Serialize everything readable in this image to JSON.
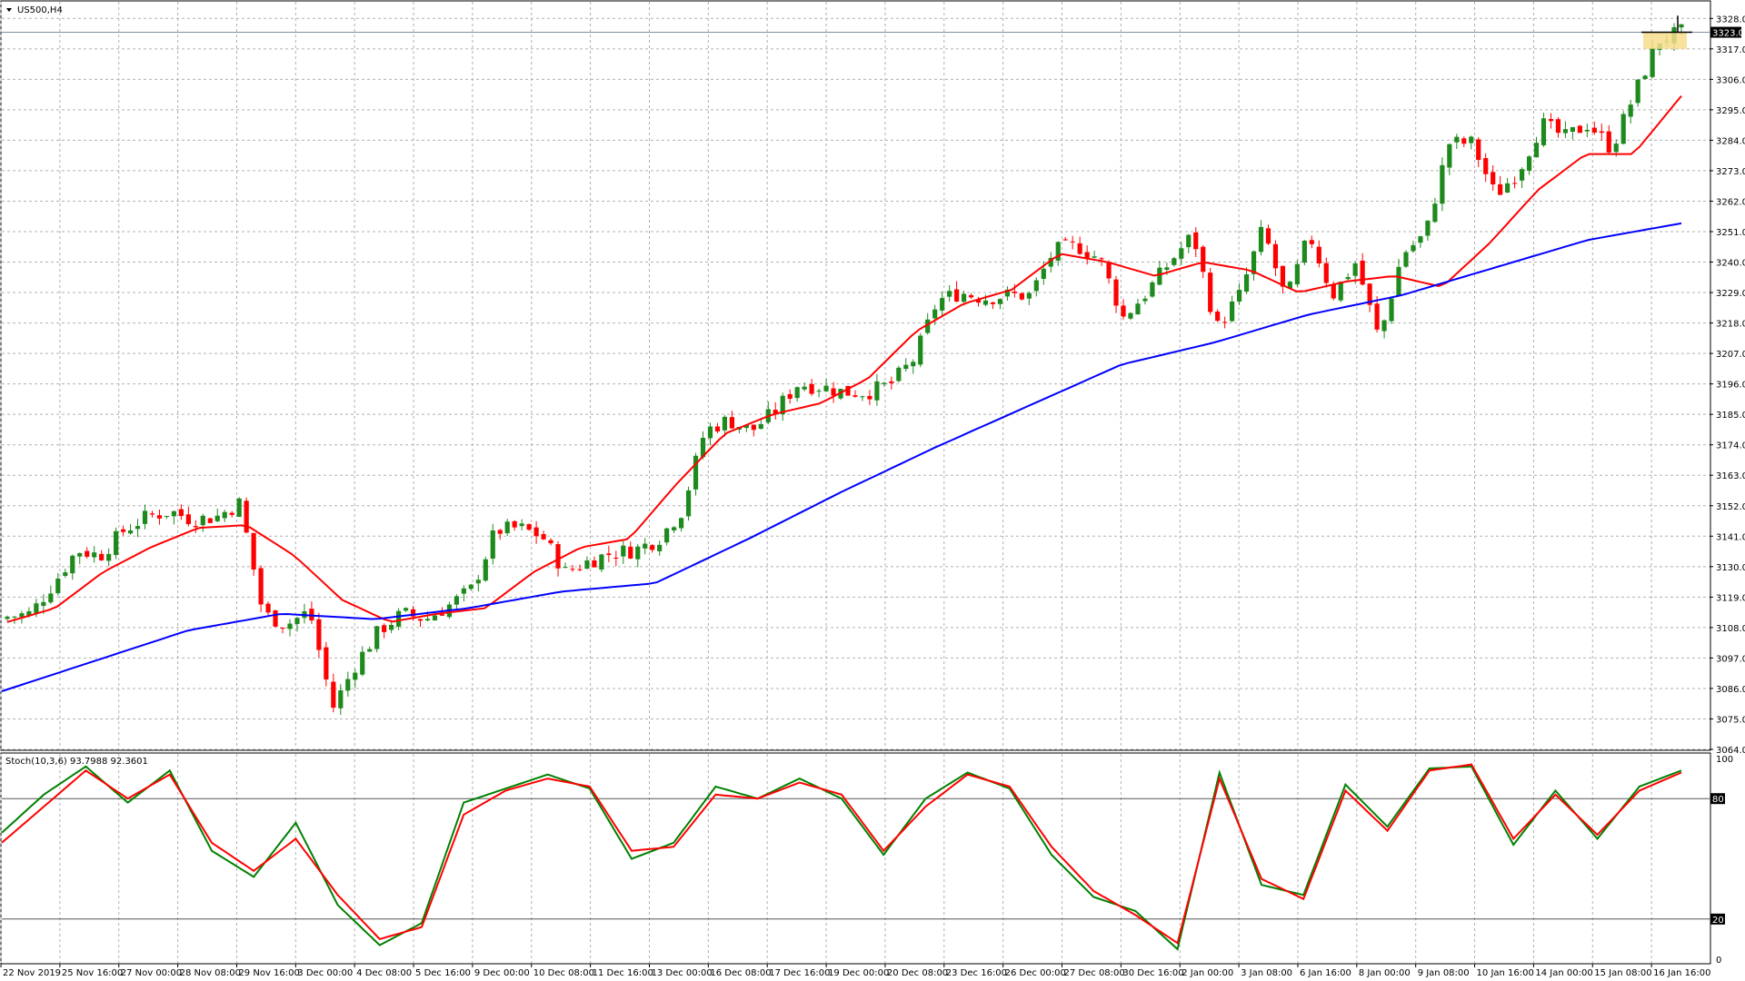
{
  "symbol_label": "US500,H4",
  "stoch_label": "Stoch(10,3,6) 93.7988 92.3601",
  "current_price_label": "3323.0",
  "colors": {
    "bull": "#1e8a1e",
    "bear": "#ff0000",
    "ma_fast": "#ff0000",
    "ma_slow": "#0000ff",
    "stoch_main": "#008000",
    "stoch_signal": "#ff0000",
    "grid": "#b0b0b0",
    "frame": "#000000",
    "highlight": "#f7dd8c"
  },
  "chart_data": [
    {
      "type": "candlestick",
      "title": "US500,H4",
      "ylim": [
        3064,
        3334
      ],
      "y_ticks": [
        "3328.0",
        "3317.0",
        "3306.0",
        "3295.0",
        "3284.0",
        "3273.0",
        "3262.0",
        "3251.0",
        "3240.0",
        "3229.0",
        "3218.0",
        "3207.0",
        "3196.0",
        "3185.0",
        "3174.0",
        "3163.0",
        "3152.0",
        "3141.0",
        "3130.0",
        "3119.0",
        "3108.0",
        "3097.0",
        "3086.0",
        "3075.0",
        "3064.0"
      ],
      "x_ticks": [
        "22 Nov 2019",
        "25 Nov 16:00",
        "27 Nov 00:00",
        "28 Nov 08:00",
        "29 Nov 16:00",
        "3 Dec 00:00",
        "4 Dec 08:00",
        "5 Dec 16:00",
        "9 Dec 00:00",
        "10 Dec 08:00",
        "11 Dec 16:00",
        "13 Dec 00:00",
        "16 Dec 08:00",
        "17 Dec 16:00",
        "19 Dec 00:00",
        "20 Dec 08:00",
        "23 Dec 16:00",
        "26 Dec 00:00",
        "27 Dec 08:00",
        "30 Dec 16:00",
        "2 Jan 00:00",
        "3 Jan 08:00",
        "6 Jan 16:00",
        "8 Jan 00:00",
        "9 Jan 08:00",
        "10 Jan 16:00",
        "14 Jan 00:00",
        "15 Jan 08:00",
        "16 Jan 16:00"
      ],
      "close_anchors": [
        3112,
        3113,
        3124,
        3136,
        3134,
        3143,
        3148,
        3150,
        3147,
        3148,
        3153,
        3113,
        3109,
        3114,
        3079,
        3095,
        3107,
        3113,
        3111,
        3116,
        3122,
        3143,
        3144,
        3141,
        3128,
        3132,
        3135,
        3136,
        3140,
        3150,
        3179,
        3183,
        3179,
        3186,
        3196,
        3195,
        3193,
        3193,
        3196,
        3205,
        3226,
        3229,
        3227,
        3228,
        3228,
        3244,
        3246,
        3241,
        3220,
        3229,
        3240,
        3250,
        3216,
        3228,
        3252,
        3226,
        3250,
        3228,
        3240,
        3212,
        3243,
        3250,
        3283,
        3283,
        3264,
        3273,
        3290,
        3285,
        3290,
        3281,
        3301,
        3320,
        3323
      ],
      "ema_fast_anchors": [
        3110,
        3115,
        3128,
        3137,
        3144,
        3145,
        3134,
        3118,
        3110,
        3113,
        3115,
        3128,
        3137,
        3140,
        3160,
        3178,
        3185,
        3189,
        3198,
        3215,
        3225,
        3230,
        3243,
        3240,
        3235,
        3240,
        3237,
        3229,
        3233,
        3235,
        3231,
        3247,
        3266,
        3279,
        3279,
        3300
      ],
      "ema_slow_anchors": [
        3085,
        3096,
        3107,
        3113,
        3111,
        3115,
        3121,
        3124,
        3140,
        3157,
        3173,
        3188,
        3203,
        3211,
        3221,
        3228,
        3238,
        3248,
        3254
      ],
      "series": [
        {
          "name": "Stoch main",
          "values": [
            63,
            82,
            96,
            78,
            94,
            54,
            41,
            68,
            27,
            7,
            18,
            78,
            85,
            92,
            85,
            50,
            58,
            86,
            80,
            90,
            80,
            52,
            80,
            93,
            85,
            52,
            31,
            24,
            5,
            93,
            37,
            32,
            87,
            66,
            95,
            96,
            57,
            84,
            60,
            86,
            94
          ]
        },
        {
          "name": "Stoch signal",
          "values": [
            58,
            76,
            94,
            80,
            92,
            58,
            44,
            60,
            32,
            10,
            16,
            72,
            84,
            90,
            86,
            54,
            56,
            82,
            80,
            88,
            82,
            54,
            76,
            92,
            86,
            56,
            34,
            22,
            8,
            90,
            40,
            30,
            84,
            64,
            94,
            97,
            60,
            82,
            62,
            84,
            93
          ]
        }
      ],
      "stoch_levels": [
        80,
        20
      ],
      "stoch_axis_labels": [
        "100",
        "80",
        "20",
        "0"
      ],
      "current_price": 3323.0
    }
  ]
}
